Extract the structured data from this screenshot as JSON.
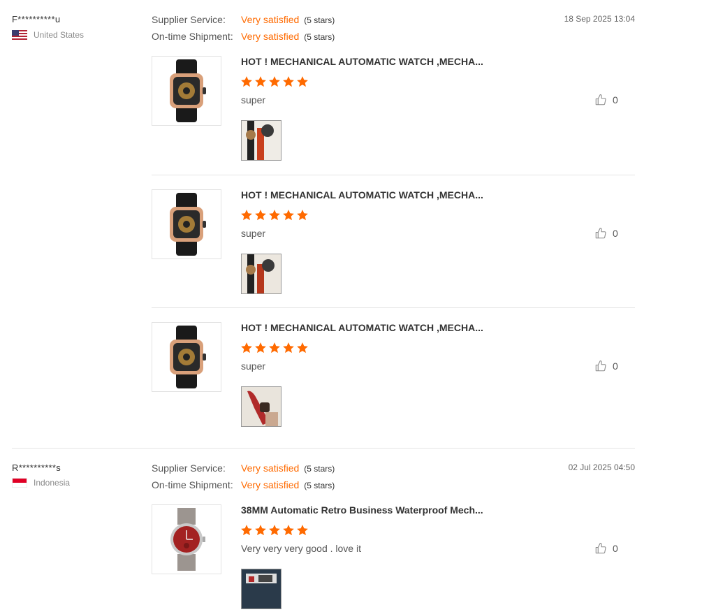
{
  "reviews": [
    {
      "buyer": "F**********u",
      "country": "United States",
      "date": "18 Sep 2025 13:04",
      "supplier_service": {
        "label": "Supplier Service:",
        "value": "Very satisfied",
        "stars": "(5 stars)"
      },
      "shipment": {
        "label": "On-time Shipment:",
        "value": "Very satisfied",
        "stars": "(5 stars)"
      },
      "items": [
        {
          "title": "HOT ! MECHANICAL AUTOMATIC WATCH ,MECHA...",
          "rating": 5,
          "text": "super",
          "likes": "0"
        },
        {
          "title": "HOT ! MECHANICAL AUTOMATIC WATCH ,MECHA...",
          "rating": 5,
          "text": "super",
          "likes": "0"
        },
        {
          "title": "HOT ! MECHANICAL AUTOMATIC WATCH ,MECHA...",
          "rating": 5,
          "text": "super",
          "likes": "0"
        }
      ]
    },
    {
      "buyer": "R**********s",
      "country": "Indonesia",
      "date": "02 Jul 2025 04:50",
      "supplier_service": {
        "label": "Supplier Service:",
        "value": "Very satisfied",
        "stars": "(5 stars)"
      },
      "shipment": {
        "label": "On-time Shipment:",
        "value": "Very satisfied",
        "stars": "(5 stars)"
      },
      "items": [
        {
          "title": "38MM Automatic Retro Business Waterproof Mech...",
          "rating": 5,
          "text": "Very very very good . love it",
          "likes": "0"
        }
      ]
    }
  ],
  "icons": {
    "star": "star-icon",
    "like": "thumbs-up-icon",
    "flag_us": "flag-us-icon",
    "flag_id": "flag-id-icon"
  },
  "colors": {
    "accent": "#ff6a00",
    "star": "#ff6a00",
    "divider": "#e5e5e5"
  }
}
